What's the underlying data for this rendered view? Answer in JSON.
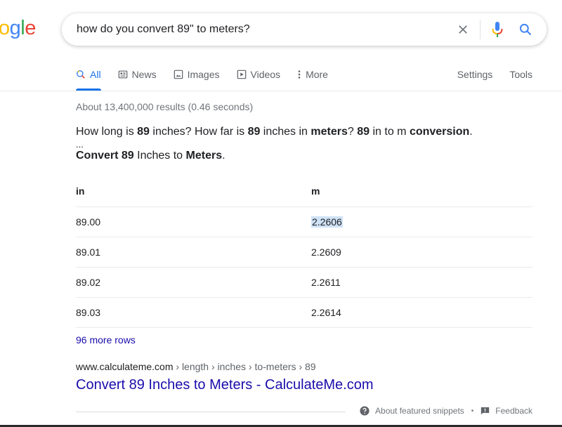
{
  "logo": {
    "letters": [
      "o",
      "g",
      "l",
      "e"
    ],
    "colors": [
      "#fbbc05",
      "#4285f4",
      "#34a853",
      "#ea4335"
    ]
  },
  "search": {
    "query": "how do you convert 89\" to meters?",
    "clear_icon": "close-icon",
    "voice_icon": "microphone-icon",
    "search_icon": "search-icon"
  },
  "tabs": [
    {
      "label": "All",
      "icon": "search-icon",
      "active": true
    },
    {
      "label": "News",
      "icon": "news-icon"
    },
    {
      "label": "Images",
      "icon": "image-icon"
    },
    {
      "label": "Videos",
      "icon": "play-icon"
    },
    {
      "label": "More",
      "icon": "more-vert-icon"
    }
  ],
  "tabs_right": [
    {
      "label": "Settings"
    },
    {
      "label": "Tools"
    }
  ],
  "stats": "About 13,400,000 results (0.46 seconds)",
  "snippet": {
    "line1": [
      {
        "t": "How long is ",
        "b": false
      },
      {
        "t": "89",
        "b": true
      },
      {
        "t": " inches? How far is ",
        "b": false
      },
      {
        "t": "89",
        "b": true
      },
      {
        "t": " inches in ",
        "b": false
      },
      {
        "t": "meters",
        "b": true
      },
      {
        "t": "? ",
        "b": false
      },
      {
        "t": "89",
        "b": true
      },
      {
        "t": " in to m ",
        "b": false
      },
      {
        "t": "conversion",
        "b": true
      },
      {
        "t": ".",
        "b": false
      }
    ],
    "ellipsis": "...",
    "line2": [
      {
        "t": "Convert 89",
        "b": true
      },
      {
        "t": " Inches to ",
        "b": false
      },
      {
        "t": "Meters",
        "b": true
      },
      {
        "t": ".",
        "b": false
      }
    ]
  },
  "table": {
    "headers": [
      "in",
      "m"
    ],
    "rows": [
      [
        "89.00",
        "2.2606"
      ],
      [
        "89.01",
        "2.2609"
      ],
      [
        "89.02",
        "2.2611"
      ],
      [
        "89.03",
        "2.2614"
      ]
    ],
    "highlighted_cell": "2.2606"
  },
  "more_rows": "96 more rows",
  "result": {
    "domain": "www.calculateme.com",
    "path": " › length › inches › to-meters › 89",
    "title": "Convert 89 Inches to Meters - CalculateMe.com"
  },
  "footer": {
    "about": "About featured snippets",
    "separator": "•",
    "feedback": "Feedback"
  }
}
